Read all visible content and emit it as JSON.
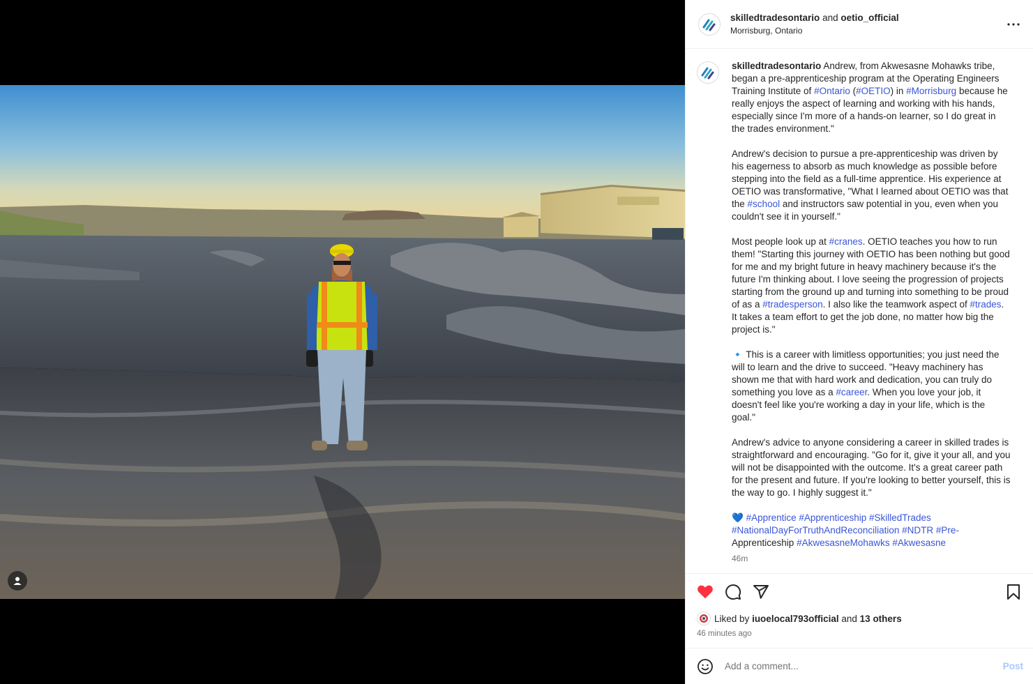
{
  "header": {
    "author": "skilledtradesontario",
    "joiner": "and",
    "coauthor": "oetio_official",
    "location": "Morrisburg, Ontario"
  },
  "caption": {
    "username": "skilledtradesontario",
    "p1_a": "Andrew, from Akwesasne Mohawks tribe, began a pre-apprenticeship program at the Operating Engineers Training Institute of",
    "p1_tag_ontario": "#Ontario",
    "p1_b": "(",
    "p1_tag_oetio": "#OETIO",
    "p1_c": ") in",
    "p1_tag_morrisburg": "#Morrisburg",
    "p1_d": "because he really enjoys the aspect of learning and working with his hands, especially since I'm more of a hands-on learner, so I do great in the trades environment.\"",
    "p2_a": "Andrew's decision to pursue a pre-apprenticeship was driven by his eagerness to absorb as much knowledge as possible before stepping into the field as a full-time apprentice. His experience at OETIO was transformative, \"What I learned about OETIO was that the",
    "p2_tag_school": "#school",
    "p2_b": "and instructors saw potential in you, even when you couldn't see it in yourself.\"",
    "p3_a": "Most people look up at",
    "p3_tag_cranes": "#cranes",
    "p3_b": ". OETIO teaches you how to run them! \"Starting this journey with OETIO has been nothing but good for me and my bright future in heavy machinery because it's the future I'm thinking about. I love seeing the progression of projects starting from the ground up and turning into something to be proud of as a",
    "p3_tag_tradesperson": "#tradesperson",
    "p3_c": ". I also like the teamwork aspect of",
    "p3_tag_trades": "#trades",
    "p3_d": ". It takes a team effort to get the job done, no matter how big the project is.\"",
    "p4_emoji": "🔹",
    "p4_a": "This is a career with limitless opportunities; you just need the will to learn and the drive to succeed. \"Heavy machinery has shown me that with hard work and dedication, you can truly do something you love as a",
    "p4_tag_career": "#career",
    "p4_b": ". When you love your job, it doesn't feel like you're working a day in your life, which is the goal.\"",
    "p5": "Andrew's advice to anyone considering a career in skilled trades is straightforward and encouraging. \"Go for it, give it your all, and you will not be disappointed with the outcome. It's a great career path for the present and future. If you're looking to better yourself, this is the way to go. I highly suggest it.\"",
    "p6_emoji": "💙",
    "p6_tags": [
      "#Apprentice",
      "#Apprenticeship",
      "#SkilledTrades",
      "#NationalDayForTruthAndReconciliation",
      "#NDTR",
      "#Pre-"
    ],
    "p6_plain": "Apprenticeship",
    "p6_tags_end": [
      "#AkwesasneMohawks",
      "#Akwesasne"
    ],
    "time": "46m"
  },
  "likes": {
    "prefix": "Liked by",
    "user": "iuoelocal793official",
    "joiner": "and",
    "others": "13 others",
    "ago": "46 minutes ago"
  },
  "comment": {
    "placeholder": "Add a comment...",
    "post_label": "Post"
  },
  "icons": {
    "more": "more-horizontal-icon",
    "like": "heart-filled-icon",
    "comment": "comment-icon",
    "share": "share-icon",
    "save": "bookmark-icon",
    "emoji": "emoji-icon",
    "tag": "user-tag-icon"
  },
  "colors": {
    "hashtag": "#3a55d8",
    "heart": "#ff3040",
    "post_disabled": "#a8c7fa"
  }
}
